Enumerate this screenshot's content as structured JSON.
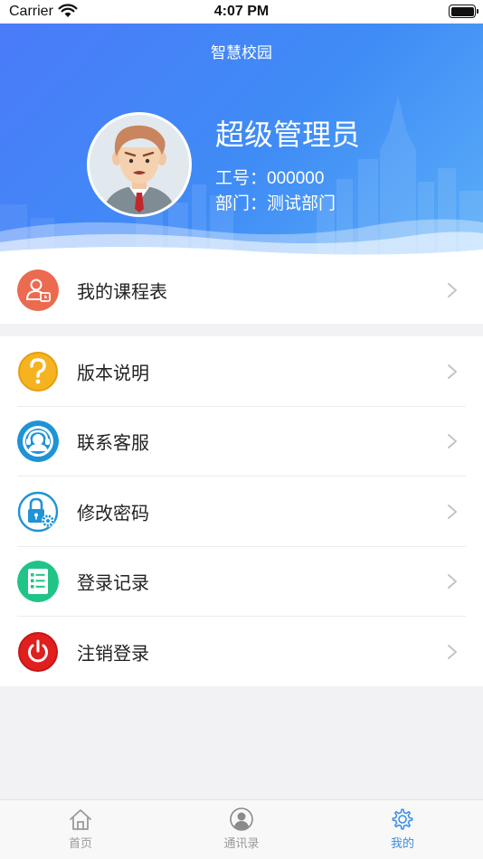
{
  "status_bar": {
    "carrier": "Carrier",
    "time": "4:07 PM"
  },
  "header": {
    "title": "智慧校园",
    "user_name": "超级管理员",
    "employee_id": "工号：000000",
    "department": "部门：测试部门"
  },
  "menu": {
    "schedule": "我的课程表",
    "version": "版本说明",
    "support": "联系客服",
    "password": "修改密码",
    "login_log": "登录记录",
    "logout": "注销登录"
  },
  "tabbar": {
    "home": "首页",
    "contacts": "通讯录",
    "mine": "我的",
    "active": "mine"
  },
  "colors": {
    "header_start": "#4a7bf8",
    "header_end": "#5aaef8",
    "tab_active": "#3a8ee6",
    "schedule_icon": "#ec6a4f",
    "version_icon": "#f5b41f",
    "support_icon": "#1f93d6",
    "password_icon": "#1f93d6",
    "login_log_icon": "#20c487",
    "logout_icon": "#e0201e"
  },
  "icons": [
    "wifi-icon",
    "battery-icon",
    "avatar",
    "schedule-icon",
    "question-icon",
    "headset-icon",
    "lock-gear-icon",
    "list-icon",
    "power-icon",
    "chevron-right-icon",
    "home-icon",
    "contacts-icon",
    "gear-icon"
  ]
}
